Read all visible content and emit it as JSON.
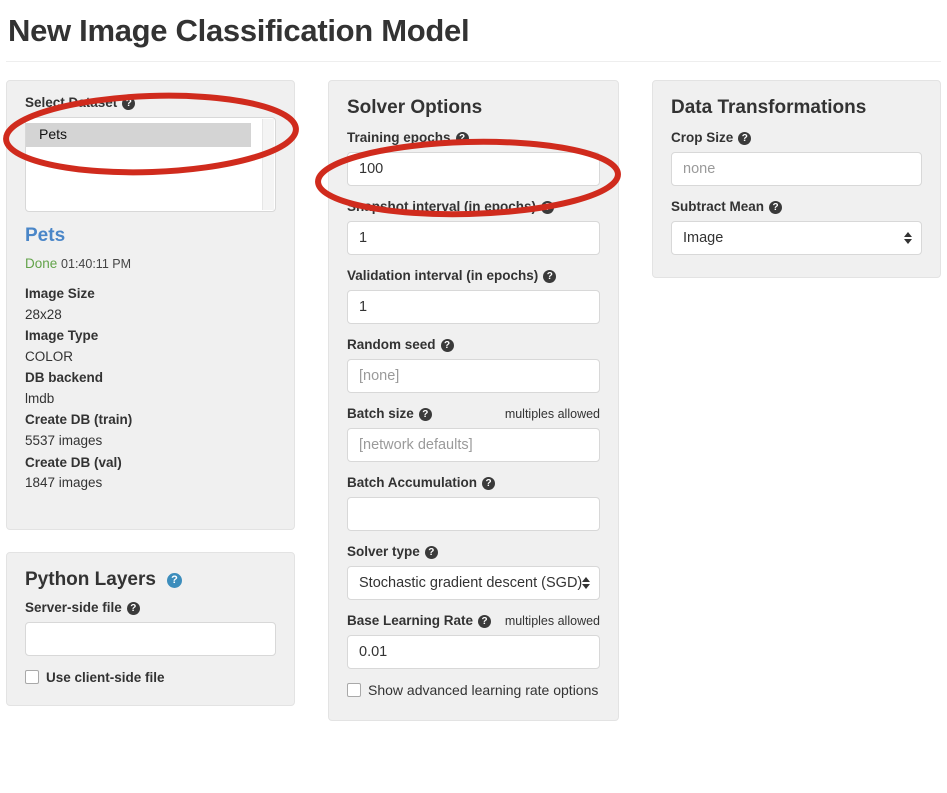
{
  "page": {
    "title": "New Image Classification Model"
  },
  "icons": {
    "help": "?",
    "help_dark": "help-icon",
    "help_blue": "help-icon-blue"
  },
  "colors": {
    "annotation": "#d02b1d",
    "link": "#4a86c8",
    "status_done": "#63a34a",
    "panel_bg": "#f0f0f0",
    "panel_border": "#e3e3e3"
  },
  "select_dataset": {
    "label": "Select Dataset",
    "options": [
      "Pets"
    ],
    "selected": "Pets",
    "summary": {
      "name": "Pets",
      "status": "Done",
      "time": "01:40:11 PM",
      "stats": [
        {
          "term": "Image Size",
          "value": "28x28"
        },
        {
          "term": "Image Type",
          "value": "COLOR"
        },
        {
          "term": "DB backend",
          "value": "lmdb"
        },
        {
          "term": "Create DB (train)",
          "value": "5537 images"
        },
        {
          "term": "Create DB (val)",
          "value": "1847 images"
        }
      ]
    }
  },
  "python_layers": {
    "title": "Python Layers",
    "server_file": {
      "label": "Server-side file",
      "value": "",
      "placeholder": ""
    },
    "use_client_file": {
      "label": "Use client-side file",
      "checked": false
    }
  },
  "solver_options": {
    "title": "Solver Options",
    "fields": [
      {
        "label": "Training epochs",
        "value": "100",
        "placeholder": "",
        "hint": ""
      },
      {
        "label": "Snapshot interval (in epochs)",
        "value": "1",
        "placeholder": "",
        "hint": ""
      },
      {
        "label": "Validation interval (in epochs)",
        "value": "1",
        "placeholder": "",
        "hint": ""
      },
      {
        "label": "Random seed",
        "value": "",
        "placeholder": "[none]",
        "hint": ""
      },
      {
        "label": "Batch size",
        "value": "",
        "placeholder": "[network defaults]",
        "hint": "multiples allowed"
      },
      {
        "label": "Batch Accumulation",
        "value": "",
        "placeholder": "",
        "hint": ""
      }
    ],
    "solver_type": {
      "label": "Solver type",
      "selected": "Stochastic gradient descent (SGD)"
    },
    "base_learning_rate": {
      "label": "Base Learning Rate",
      "hint": "multiples allowed",
      "value": "0.01"
    },
    "advanced_lr": {
      "label": "Show advanced learning rate options",
      "checked": false
    }
  },
  "data_transformations": {
    "title": "Data Transformations",
    "crop_size": {
      "label": "Crop Size",
      "value": "",
      "placeholder": "none"
    },
    "subtract_mean": {
      "label": "Subtract Mean",
      "selected": "Image"
    }
  }
}
